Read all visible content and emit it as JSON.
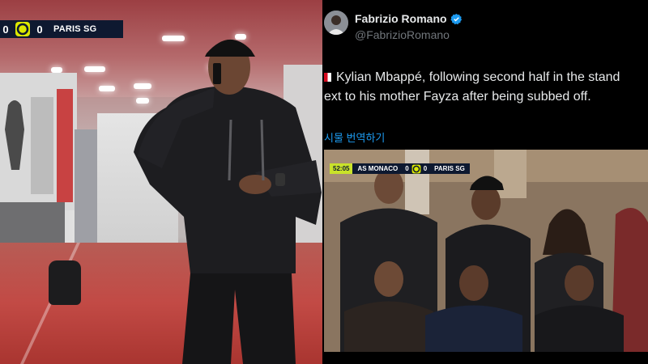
{
  "left_frame": {
    "scorebug": {
      "home_score": "0",
      "away_score": "0",
      "away_team": "PARIS SG"
    }
  },
  "tweet": {
    "author_name": "Fabrizio Romano",
    "handle": "@FabrizioRomano",
    "text_line1": "Kylian Mbappé, following second half in the stand",
    "text_line2": "ext to his mother Fayza after being subbed off.",
    "translate_link": "시물 번역하기",
    "media": {
      "scorebug": {
        "clock": "52:05",
        "home_team": "AS MONACO",
        "home_score": "0",
        "away_score": "0",
        "away_team": "PARIS SG"
      }
    }
  },
  "colors": {
    "scorebug_bg": "#0e1930",
    "link_blue": "#1d9bf0",
    "verified_blue": "#1d9bf0",
    "clock_bg": "#c9e22a"
  },
  "icons": [
    "ligue1-logo-icon",
    "verified-badge-icon",
    "france-flag-icon"
  ]
}
